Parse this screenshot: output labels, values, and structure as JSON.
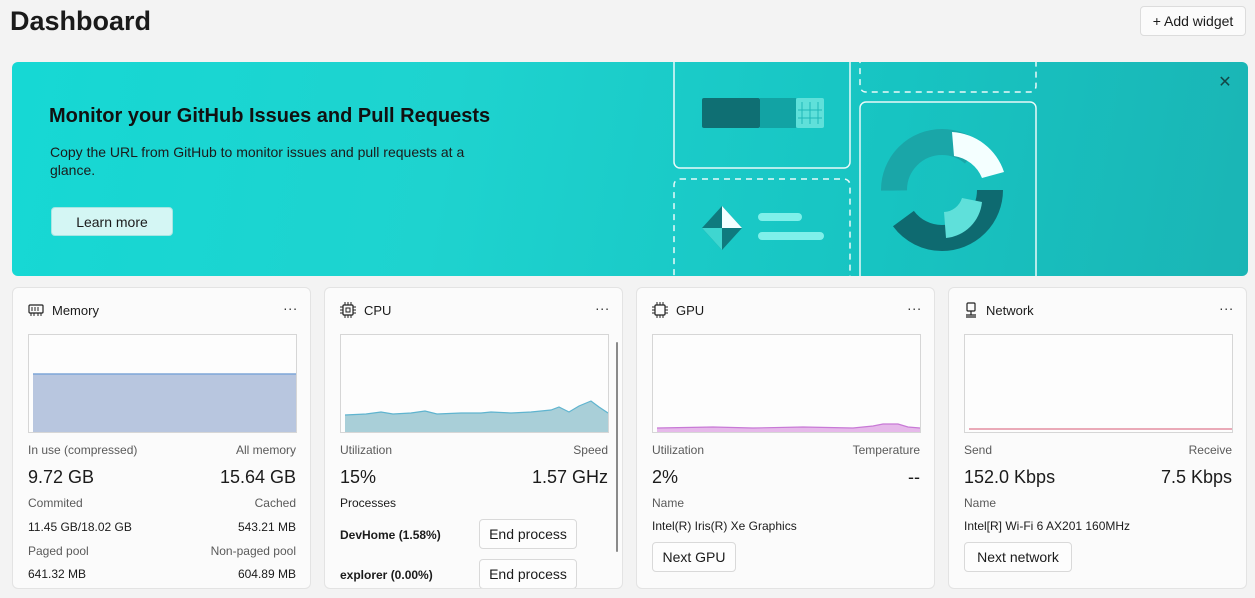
{
  "header": {
    "title": "Dashboard",
    "add_widget_label": "+ Add widget"
  },
  "banner": {
    "title": "Monitor your GitHub Issues and Pull Requests",
    "description": "Copy the URL from GitHub to monitor issues and pull requests at a glance.",
    "learn_more_label": "Learn more",
    "close_icon": "close-icon",
    "color": "#16d8d4"
  },
  "widgets": {
    "memory": {
      "title": "Memory",
      "icon": "memory-chip-icon",
      "more": "...",
      "in_use_label": "In use (compressed)",
      "in_use_value": "9.72 GB",
      "all_memory_label": "All memory",
      "all_memory_value": "15.64 GB",
      "committed_label": "Commited",
      "committed_value": "11.45 GB/18.02 GB",
      "cached_label": "Cached",
      "cached_value": "543.21 MB",
      "paged_label": "Paged pool",
      "paged_value": "641.32 MB",
      "nonpaged_label": "Non-paged pool",
      "nonpaged_value": "604.89 MB",
      "chart_color": "#9fb3d9"
    },
    "cpu": {
      "title": "CPU",
      "icon": "processor-icon",
      "more": "...",
      "utilization_label": "Utilization",
      "utilization_value": "15%",
      "speed_label": "Speed",
      "speed_value": "1.57 GHz",
      "processes_label": "Processes",
      "processes": [
        {
          "name": "DevHome (1.58%)",
          "action": "End process"
        },
        {
          "name": "explorer (0.00%)",
          "action": "End process"
        }
      ],
      "chart_color": "#7ec4d6"
    },
    "gpu": {
      "title": "GPU",
      "icon": "processor-icon",
      "more": "...",
      "utilization_label": "Utilization",
      "utilization_value": "2%",
      "temperature_label": "Temperature",
      "temperature_value": "--",
      "name_label": "Name",
      "name_value": "Intel(R) Iris(R) Xe Graphics",
      "next_label": "Next GPU",
      "chart_color": "#d79be0"
    },
    "network": {
      "title": "Network",
      "icon": "network-icon",
      "more": "...",
      "send_label": "Send",
      "send_value": "152.0 Kbps",
      "receive_label": "Receive",
      "receive_value": "7.5 Kbps",
      "name_label": "Name",
      "name_value": "Intel[R] Wi-Fi 6 AX201 160MHz",
      "next_label": "Next network",
      "chart_color": "#e07a8e"
    }
  }
}
